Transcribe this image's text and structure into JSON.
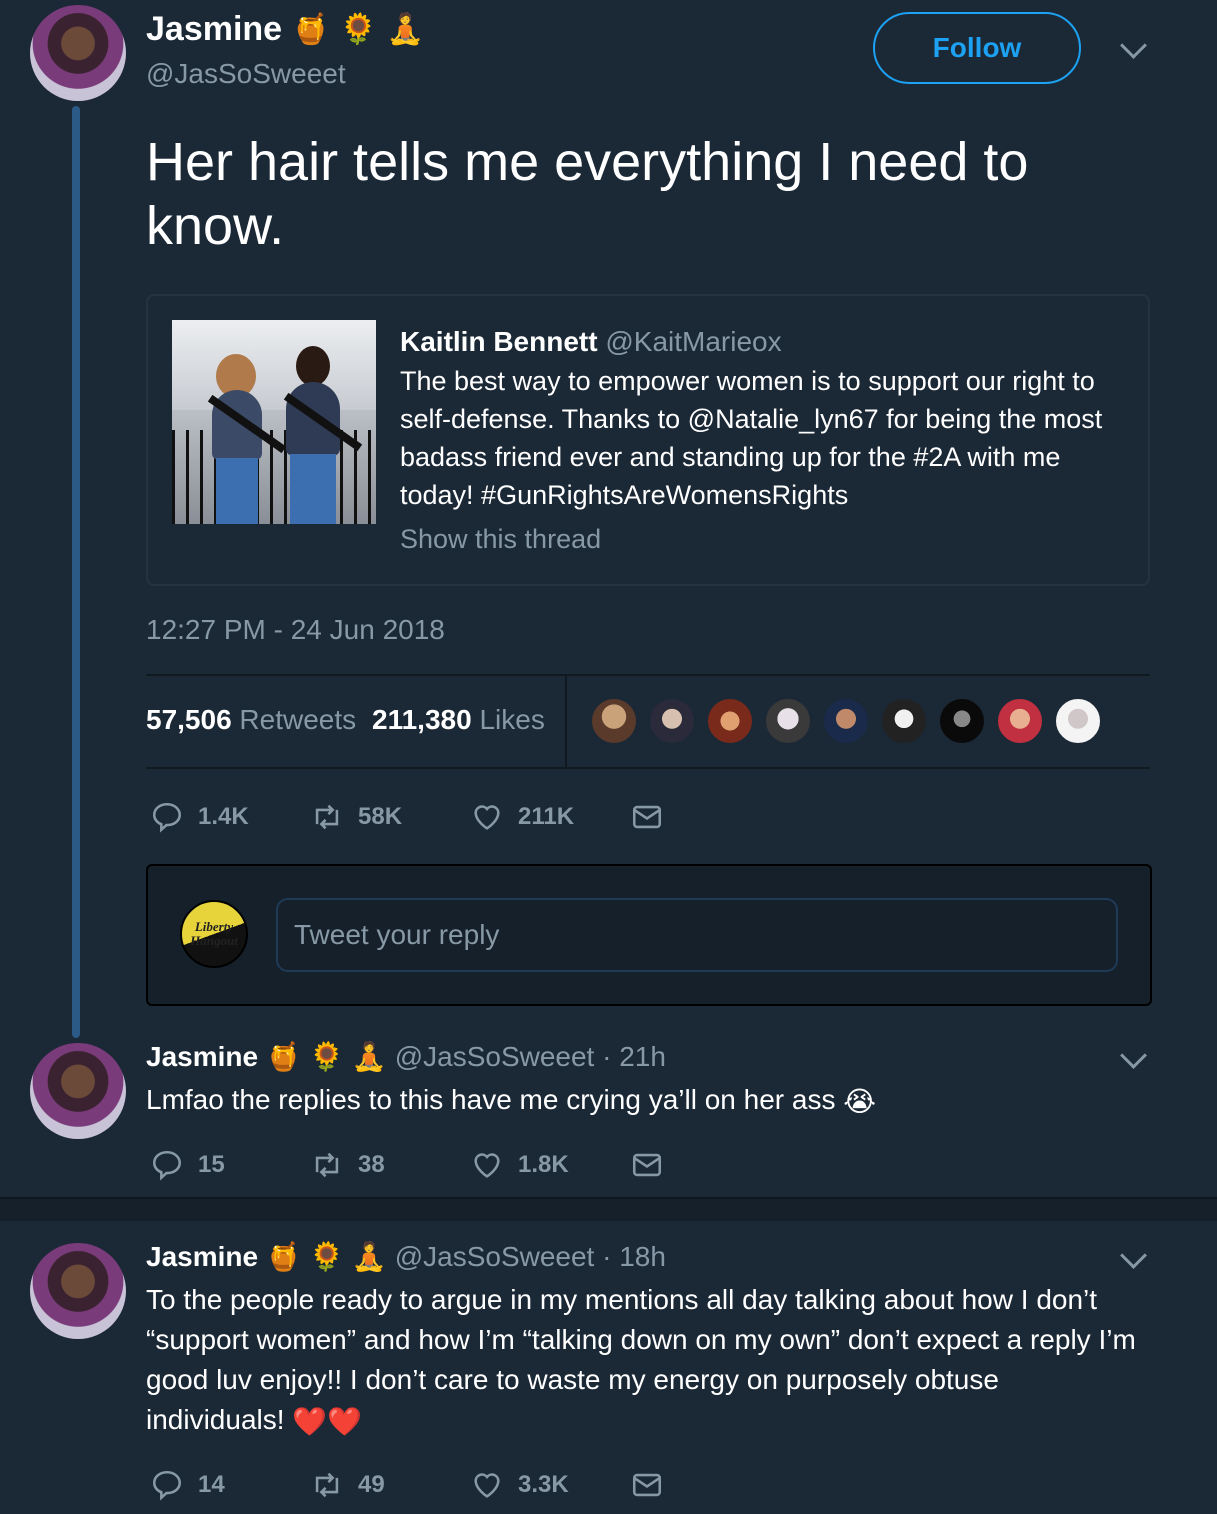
{
  "main_tweet": {
    "display_name": "Jasmine",
    "emojis": [
      "🍯",
      "🌻",
      "🧘"
    ],
    "handle": "@JasSoSweeet",
    "follow_label": "Follow",
    "text": "Her hair tells me everything I need to know.",
    "timestamp": "12:27 PM - 24 Jun 2018",
    "retweets_count": "57,506",
    "retweets_label": "Retweets",
    "likes_count": "211,380",
    "likes_label": "Likes",
    "actions": {
      "replies": "1.4K",
      "retweets": "58K",
      "likes": "211K"
    }
  },
  "quoted_tweet": {
    "display_name": "Kaitlin Bennett",
    "handle": "@KaitMarieox",
    "text": "The best way to empower women is to support our right to self-defense. Thanks to @Natalie_lyn67 for being the most badass friend ever and standing up for the #2A with me today! #GunRightsAreWomensRights",
    "show_thread": "Show this thread"
  },
  "reply_composer": {
    "avatar_text": "Liberty Hangout",
    "placeholder": "Tweet your reply"
  },
  "replies": [
    {
      "display_name": "Jasmine",
      "emojis": [
        "🍯",
        "🌻",
        "🧘"
      ],
      "handle_time": "@JasSoSweeet · 21h",
      "text": "Lmfao the replies to this have me crying ya’ll on her ass",
      "text_emoji": "😭",
      "actions": {
        "replies": "15",
        "retweets": "38",
        "likes": "1.8K"
      }
    },
    {
      "display_name": "Jasmine",
      "emojis": [
        "🍯",
        "🌻",
        "🧘"
      ],
      "handle_time": "@JasSoSweeet · 18h",
      "text": "To the people ready to argue in my mentions all day talking about how I don’t “support women” and how I’m “talking down on my own” don’t expect a reply I’m good luv enjoy!! I don’t care to waste my energy on purposely obtuse individuals!",
      "text_emoji": "❤️❤️",
      "actions": {
        "replies": "14",
        "retweets": "49",
        "likes": "3.3K"
      }
    }
  ],
  "icons": {
    "reply": "speech-bubble-icon",
    "retweet": "retweet-arrows-icon",
    "like": "heart-icon",
    "message": "envelope-icon",
    "more": "chevron-down-icon"
  },
  "colors": {
    "background": "#1b2836",
    "accent": "#1da1f2",
    "muted": "#8899a6",
    "heart_red": "#e0245e"
  }
}
